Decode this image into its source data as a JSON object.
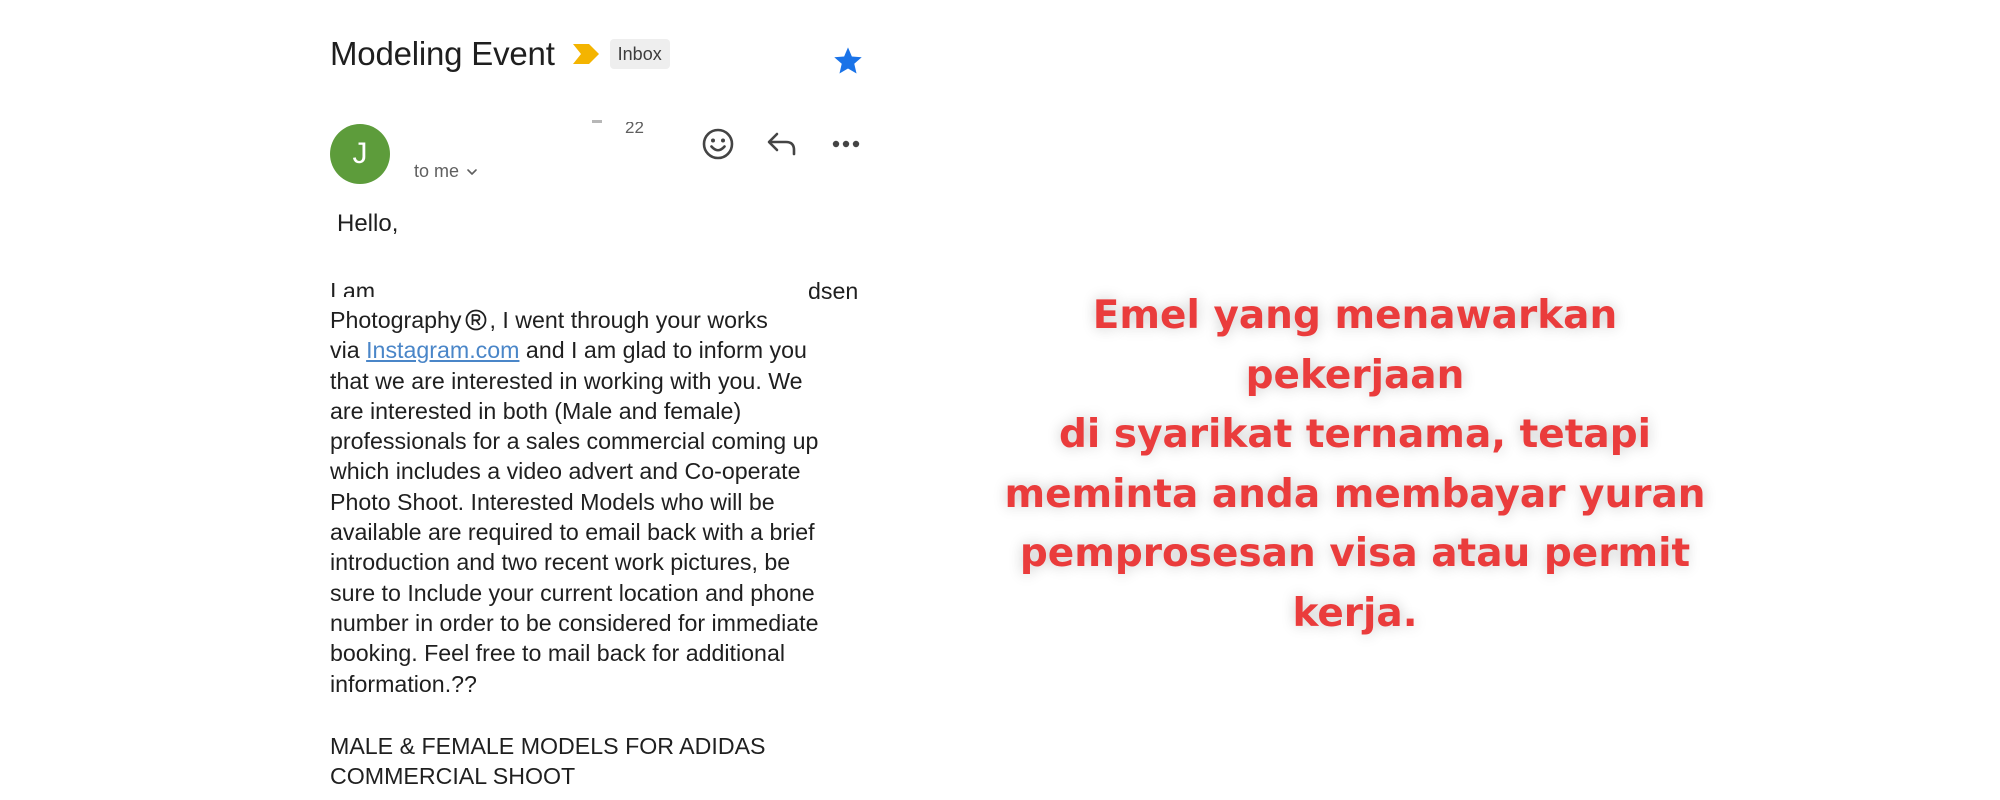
{
  "email": {
    "subject": "Modeling Event",
    "label": "Inbox",
    "sender_initial": "J",
    "sender_time_fragment": "22",
    "recipient": "to me",
    "greeting": "Hello,",
    "body_line1": "I am",
    "body_line1_tail": "dsen",
    "body_line2_a": "Photography",
    "body_line2_b": ", I went through your works",
    "body_line3_a": "via",
    "body_link": "Instagram.com",
    "body_line3_b": "and I am glad to inform you",
    "body_lines": [
      "that we are interested in working with you. We",
      "are interested in both (Male and female)",
      "professionals for a sales commercial coming up",
      "which includes a video advert and Co-operate",
      "Photo Shoot. Interested Models who will be",
      "available are required to email back with a brief",
      "introduction and two recent work pictures, be",
      "sure to Include your current location and phone",
      "number in order to be considered for immediate",
      "booking. Feel free to mail back for additional",
      "information.??"
    ],
    "closing_lines": [
      "MALE & FEMALE MODELS FOR ADIDAS",
      "COMMERCIAL SHOOT"
    ]
  },
  "caption": {
    "lines": [
      "Emel yang menawarkan pekerjaan",
      "di syarikat ternama, tetapi",
      "meminta anda membayar yuran",
      "pemprosesan visa atau permit",
      "kerja."
    ]
  },
  "icons": {
    "importance": "importance-marker-icon",
    "star": "star-icon",
    "emoji": "emoji-reaction-icon",
    "reply": "reply-icon",
    "more": "more-options-icon",
    "chevron": "chevron-down-icon",
    "registered": "registered-trademark-icon"
  },
  "colors": {
    "importance": "#f4b400",
    "star": "#1a73e8",
    "avatar": "#5d9c3b",
    "link": "#4a86c8",
    "caption": "#ea3c3c"
  }
}
